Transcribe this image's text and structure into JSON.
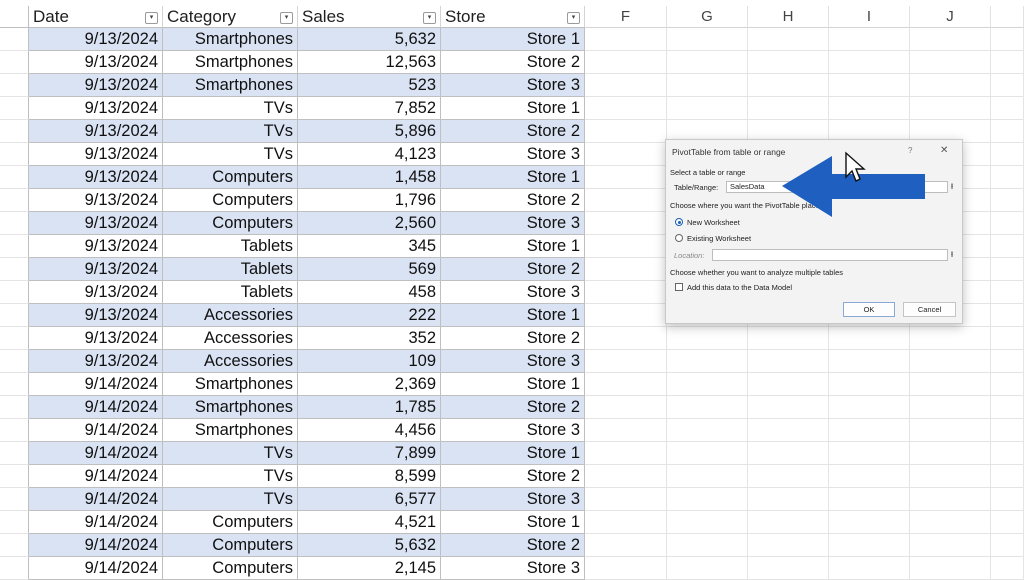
{
  "sheet": {
    "headers": [
      {
        "label": "Date"
      },
      {
        "label": "Category"
      },
      {
        "label": "Sales"
      },
      {
        "label": "Store"
      }
    ],
    "extra_columns": [
      "F",
      "G",
      "H",
      "I",
      "J"
    ],
    "rows": [
      {
        "date": "9/13/2024",
        "category": "Smartphones",
        "sales": "5,632",
        "store": "Store 1"
      },
      {
        "date": "9/13/2024",
        "category": "Smartphones",
        "sales": "12,563",
        "store": "Store 2"
      },
      {
        "date": "9/13/2024",
        "category": "Smartphones",
        "sales": "523",
        "store": "Store 3"
      },
      {
        "date": "9/13/2024",
        "category": "TVs",
        "sales": "7,852",
        "store": "Store 1"
      },
      {
        "date": "9/13/2024",
        "category": "TVs",
        "sales": "5,896",
        "store": "Store 2"
      },
      {
        "date": "9/13/2024",
        "category": "TVs",
        "sales": "4,123",
        "store": "Store 3"
      },
      {
        "date": "9/13/2024",
        "category": "Computers",
        "sales": "1,458",
        "store": "Store 1"
      },
      {
        "date": "9/13/2024",
        "category": "Computers",
        "sales": "1,796",
        "store": "Store 2"
      },
      {
        "date": "9/13/2024",
        "category": "Computers",
        "sales": "2,560",
        "store": "Store 3"
      },
      {
        "date": "9/13/2024",
        "category": "Tablets",
        "sales": "345",
        "store": "Store 1"
      },
      {
        "date": "9/13/2024",
        "category": "Tablets",
        "sales": "569",
        "store": "Store 2"
      },
      {
        "date": "9/13/2024",
        "category": "Tablets",
        "sales": "458",
        "store": "Store 3"
      },
      {
        "date": "9/13/2024",
        "category": "Accessories",
        "sales": "222",
        "store": "Store 1"
      },
      {
        "date": "9/13/2024",
        "category": "Accessories",
        "sales": "352",
        "store": "Store 2"
      },
      {
        "date": "9/13/2024",
        "category": "Accessories",
        "sales": "109",
        "store": "Store 3"
      },
      {
        "date": "9/14/2024",
        "category": "Smartphones",
        "sales": "2,369",
        "store": "Store 1"
      },
      {
        "date": "9/14/2024",
        "category": "Smartphones",
        "sales": "1,785",
        "store": "Store 2"
      },
      {
        "date": "9/14/2024",
        "category": "Smartphones",
        "sales": "4,456",
        "store": "Store 3"
      },
      {
        "date": "9/14/2024",
        "category": "TVs",
        "sales": "7,899",
        "store": "Store 1"
      },
      {
        "date": "9/14/2024",
        "category": "TVs",
        "sales": "8,599",
        "store": "Store 2"
      },
      {
        "date": "9/14/2024",
        "category": "TVs",
        "sales": "6,577",
        "store": "Store 3"
      },
      {
        "date": "9/14/2024",
        "category": "Computers",
        "sales": "4,521",
        "store": "Store 1"
      },
      {
        "date": "9/14/2024",
        "category": "Computers",
        "sales": "5,632",
        "store": "Store 2"
      },
      {
        "date": "9/14/2024",
        "category": "Computers",
        "sales": "2,145",
        "store": "Store 3"
      }
    ],
    "band_color": "#dae3f3"
  },
  "dialog": {
    "title": "PivotTable from table or range",
    "help": "?",
    "close": "✕",
    "select_label": "Select a table or range",
    "table_range_label": "Table/Range:",
    "table_range_value": "SalesData",
    "choose_where": "Choose where you want the PivotTable ",
    "choose_where_tail": "placed",
    "new_worksheet": "New Worksheet",
    "existing_worksheet": "Existing Worksheet",
    "location_label": "Location:",
    "location_value": "",
    "analyze_label": "Choose whether you want to analyze multiple tables",
    "data_model_label": "Add this data to the Data Model",
    "ok": "OK",
    "cancel": "Cancel",
    "selected_option": "new_worksheet"
  },
  "annotation": {
    "arrow_color": "#1f5fbf",
    "arrow_icon": "left-arrow-icon",
    "cursor_icon": "mouse-pointer-icon"
  }
}
